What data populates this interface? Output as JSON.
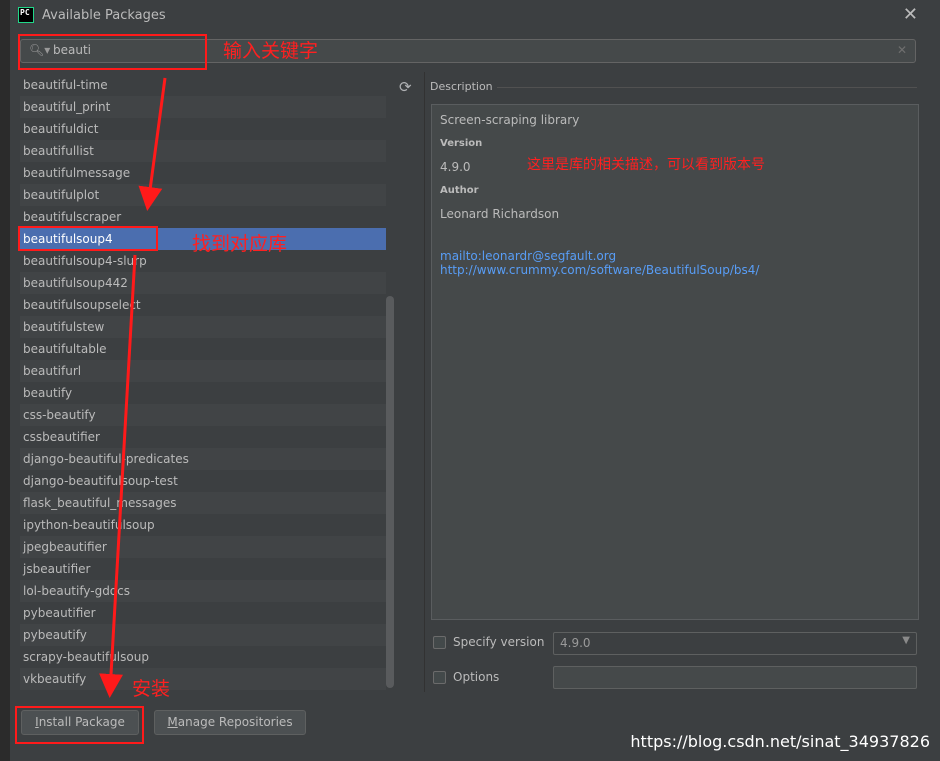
{
  "window": {
    "title": "Available Packages",
    "app_icon_text": "PC"
  },
  "search": {
    "value": "beauti"
  },
  "packages": [
    "beautiful-time",
    "beautiful_print",
    "beautifuldict",
    "beautifullist",
    "beautifulmessage",
    "beautifulplot",
    "beautifulscraper",
    "beautifulsoup4",
    "beautifulsoup4-slurp",
    "beautifulsoup442",
    "beautifulsoupselect",
    "beautifulstew",
    "beautifultable",
    "beautifurl",
    "beautify",
    "css-beautify",
    "cssbeautifier",
    "django-beautiful-predicates",
    "django-beautifulsoup-test",
    "flask_beautiful_messages",
    "ipython-beautifulsoup",
    "jpegbeautifier",
    "jsbeautifier",
    "lol-beautify-gdocs",
    "pybeautifier",
    "pybeautify",
    "scrapy-beautifulsoup",
    "vkbeautify"
  ],
  "selected_index": 7,
  "description": {
    "label": "Description",
    "summary": "Screen-scraping library",
    "version_label": "Version",
    "version": "4.9.0",
    "author_label": "Author",
    "author": "Leonard Richardson",
    "links": [
      "mailto:leonardr@segfault.org",
      "http://www.crummy.com/software/BeautifulSoup/bs4/"
    ]
  },
  "options": {
    "specify_version_label": "Specify version",
    "specify_version_value": "4.9.0",
    "options_label": "Options",
    "options_value": ""
  },
  "buttons": {
    "install_first": "I",
    "install_rest": "nstall Package",
    "manage_first": "M",
    "manage_rest": "anage Repositories"
  },
  "annotations": {
    "enter_keyword": "输入关键字",
    "find_library": "找到对应库",
    "description_note": "这里是库的相关描述，可以看到版本号",
    "install": "安装"
  },
  "watermark": "https://blog.csdn.net/sinat_34937826",
  "colors": {
    "accent_selection": "#4b6eaf",
    "annotation_red": "#ff1a1a",
    "link": "#589df6"
  }
}
